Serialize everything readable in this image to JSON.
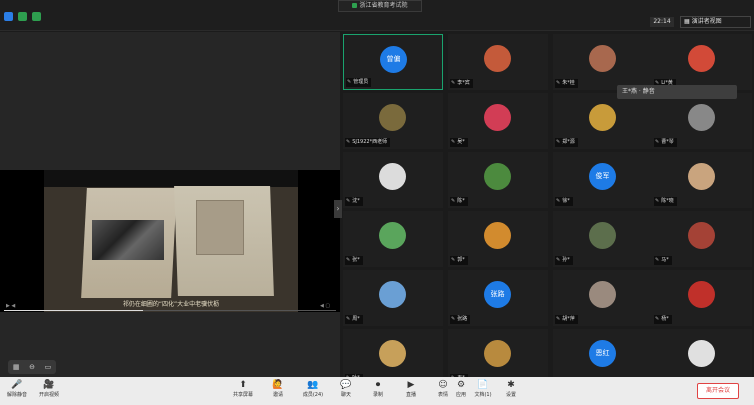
{
  "titlebar": {
    "meeting_title": "浙江省教育考试院",
    "time": "22:14",
    "speaker_view": "演讲者视图"
  },
  "share": {
    "caption": "祁仍在细圃的“四化”大业中老骥伏枥",
    "progress": 0.42
  },
  "participants": [
    {
      "name": "管理员",
      "avatar_text": "曾偏",
      "avatar_color": "#1e7be6",
      "active": true
    },
    {
      "name": "李*宾",
      "avatar_text": "",
      "avatar_color": "#c45a3a"
    },
    {
      "name": "朱*桂",
      "avatar_text": "",
      "avatar_color": "#a8684e"
    },
    {
      "name": "Li*黄",
      "avatar_text": "",
      "avatar_color": "#d24a38"
    },
    {
      "name": "SJ1922*西老师",
      "avatar_text": "",
      "avatar_color": "#7a6a3c"
    },
    {
      "name": "吴*",
      "avatar_text": "",
      "avatar_color": "#d23d55"
    },
    {
      "name": "郑*源",
      "avatar_text": "",
      "avatar_color": "#c89b3a"
    },
    {
      "name": "曹*琴",
      "avatar_text": "",
      "avatar_color": "#888"
    },
    {
      "name": "沈*",
      "avatar_text": "",
      "avatar_color": "#dcdcdc"
    },
    {
      "name": "陈*",
      "avatar_text": "",
      "avatar_color": "#4c8a3e"
    },
    {
      "name": "徐*",
      "avatar_text": "俊军",
      "avatar_color": "#1e7be6"
    },
    {
      "name": "陈*晓",
      "avatar_text": "",
      "avatar_color": "#c9a47e"
    },
    {
      "name": "张*",
      "avatar_text": "",
      "avatar_color": "#5aa55c"
    },
    {
      "name": "郭*",
      "avatar_text": "",
      "avatar_color": "#d28b2e"
    },
    {
      "name": "孙*",
      "avatar_text": "",
      "avatar_color": "#5c6e4c"
    },
    {
      "name": "马*",
      "avatar_text": "",
      "avatar_color": "#a44236"
    },
    {
      "name": "周*",
      "avatar_text": "",
      "avatar_color": "#6a9fd4"
    },
    {
      "name": "张路",
      "avatar_text": "张路",
      "avatar_color": "#1e7be6"
    },
    {
      "name": "胡*萍",
      "avatar_text": "",
      "avatar_color": "#9a8a7e"
    },
    {
      "name": "杨*",
      "avatar_text": "",
      "avatar_color": "#c0302a"
    },
    {
      "name": "叶*",
      "avatar_text": "",
      "avatar_color": "#c7a05a"
    },
    {
      "name": "王*",
      "avatar_text": "",
      "avatar_color": "#b88a3e"
    },
    {
      "name": "",
      "avatar_text": "恩红",
      "avatar_color": "#1e7be6"
    },
    {
      "name": "",
      "avatar_text": "",
      "avatar_color": "#e0e0e0"
    }
  ],
  "hover_tooltip": "王*燕 · 静音",
  "toolbar": {
    "buttons": [
      {
        "icon": "🎤",
        "label": "解除静音"
      },
      {
        "icon": "🎥",
        "label": "开启视频"
      },
      {
        "icon": "⬆",
        "label": "共享屏幕"
      },
      {
        "icon": "🙋",
        "label": "邀请"
      },
      {
        "icon": "👥",
        "label": "成员(24)"
      },
      {
        "icon": "💬",
        "label": "聊天"
      },
      {
        "icon": "⏺",
        "label": "录制"
      },
      {
        "icon": "▶",
        "label": "直播"
      },
      {
        "icon": "☺",
        "label": "表情"
      },
      {
        "icon": "⚙",
        "label": "应用"
      },
      {
        "icon": "📄",
        "label": "文档(1)"
      },
      {
        "icon": "✱",
        "label": "设置"
      }
    ],
    "end_label": "离开会议"
  }
}
